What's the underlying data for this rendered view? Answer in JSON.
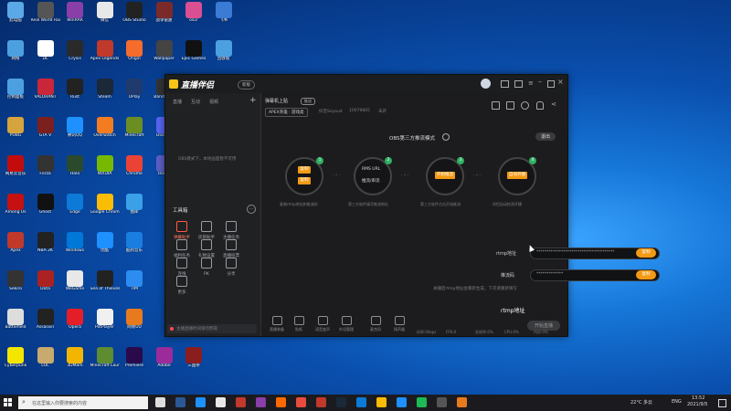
{
  "desktop": {
    "icons": [
      {
        "label": "此电脑",
        "color": "#5aa9e6",
        "c": 0,
        "r": 0
      },
      {
        "label": "Real World Racing",
        "color": "#555",
        "c": 1,
        "r": 0
      },
      {
        "label": "WinRAR",
        "color": "#8a3ea8",
        "c": 2,
        "r": 0
      },
      {
        "label": "微信",
        "color": "#e8e8e8",
        "c": 3,
        "r": 0
      },
      {
        "label": "OBS Studio",
        "color": "#222",
        "c": 4,
        "r": 0
      },
      {
        "label": "战争雷霆",
        "color": "#7b2a2a",
        "c": 5,
        "r": 0
      },
      {
        "label": "osu!",
        "color": "#d94f92",
        "c": 6,
        "r": 0
      },
      {
        "label": "飞书",
        "color": "#3a7bd5",
        "c": 7,
        "r": 0
      },
      {
        "label": "网络",
        "color": "#4da0e0",
        "c": 0,
        "r": 1
      },
      {
        "label": "DL",
        "color": "#fff",
        "c": 1,
        "r": 1
      },
      {
        "label": "Crysis",
        "color": "#2a2a2a",
        "c": 2,
        "r": 1
      },
      {
        "label": "Apex Legends",
        "color": "#c0392b",
        "c": 3,
        "r": 1
      },
      {
        "label": "Origin",
        "color": "#f56c2d",
        "c": 4,
        "r": 1
      },
      {
        "label": "Wallpaper",
        "color": "#444",
        "c": 5,
        "r": 1
      },
      {
        "label": "Epic Games",
        "color": "#111",
        "c": 6,
        "r": 1
      },
      {
        "label": "回收站",
        "color": "#4da0e0",
        "c": 7,
        "r": 1
      },
      {
        "label": "控制面板",
        "color": "#4da0e0",
        "c": 0,
        "r": 2
      },
      {
        "label": "VALORANT",
        "color": "#c9263a",
        "c": 1,
        "r": 2
      },
      {
        "label": "Rust",
        "color": "#222",
        "c": 2,
        "r": 2
      },
      {
        "label": "Steam",
        "color": "#1b2838",
        "c": 3,
        "r": 2
      },
      {
        "label": "UPlay",
        "color": "#203a6e",
        "c": 4,
        "r": 2
      },
      {
        "label": "Bandicam",
        "color": "#333",
        "c": 5,
        "r": 2
      },
      {
        "label": "直播伴侣",
        "color": "#111",
        "c": 6,
        "r": 2
      },
      {
        "label": "PUBG",
        "color": "#d6a43c",
        "c": 0,
        "r": 3
      },
      {
        "label": "GTA V",
        "color": "#7c1f1f",
        "c": 1,
        "r": 3
      },
      {
        "label": "腾讯QQ",
        "color": "#1e90ff",
        "c": 2,
        "r": 3
      },
      {
        "label": "Overwatch",
        "color": "#f47c20",
        "c": 3,
        "r": 3
      },
      {
        "label": "Minecraft",
        "color": "#6b8e23",
        "c": 4,
        "r": 3
      },
      {
        "label": "Discord",
        "color": "#5865f2",
        "c": 5,
        "r": 3
      },
      {
        "label": "网易云音乐",
        "color": "#c20c0c",
        "c": 0,
        "r": 4
      },
      {
        "label": "Forza",
        "color": "#333",
        "c": 1,
        "r": 4
      },
      {
        "label": "Halo",
        "color": "#2b4a2b",
        "c": 2,
        "r": 4
      },
      {
        "label": "NVIDIA",
        "color": "#76b900",
        "c": 3,
        "r": 4
      },
      {
        "label": "Chrome",
        "color": "#ea4335",
        "c": 4,
        "r": 4
      },
      {
        "label": "Teams",
        "color": "#5b5fc7",
        "c": 5,
        "r": 4
      },
      {
        "label": "Among Us",
        "color": "#c51111",
        "c": 0,
        "r": 5
      },
      {
        "label": "Ghost",
        "color": "#111",
        "c": 1,
        "r": 5
      },
      {
        "label": "Edge",
        "color": "#0c7ad6",
        "c": 2,
        "r": 5
      },
      {
        "label": "Google Chrome",
        "color": "#fbbc05",
        "c": 3,
        "r": 5
      },
      {
        "label": "图库",
        "color": "#3aa0e8",
        "c": 4,
        "r": 5
      },
      {
        "label": "Apex",
        "color": "#c0392b",
        "c": 0,
        "r": 6
      },
      {
        "label": "NBA 2K",
        "color": "#222",
        "c": 1,
        "r": 6
      },
      {
        "label": "Windows",
        "color": "#0078d7",
        "c": 2,
        "r": 6
      },
      {
        "label": "优酷",
        "color": "#1e90ff",
        "c": 3,
        "r": 6
      },
      {
        "label": "酷狗音乐",
        "color": "#1a7de0",
        "c": 4,
        "r": 6
      },
      {
        "label": "Sekiro",
        "color": "#333",
        "c": 0,
        "r": 7
      },
      {
        "label": "Dota",
        "color": "#a22",
        "c": 1,
        "r": 7
      },
      {
        "label": "WeGame",
        "color": "#e8e8e8",
        "c": 2,
        "r": 7
      },
      {
        "label": "Sea of Thieves",
        "color": "#222",
        "c": 3,
        "r": 7
      },
      {
        "label": "TIM",
        "color": "#2d8cf0",
        "c": 4,
        "r": 7
      },
      {
        "label": "Battlefield",
        "color": "#ddd",
        "c": 0,
        "r": 8
      },
      {
        "label": "Assassin",
        "color": "#222",
        "c": 1,
        "r": 8
      },
      {
        "label": "Opera",
        "color": "#e41e26",
        "c": 2,
        "r": 8
      },
      {
        "label": "PotPlayer",
        "color": "#f0f0f0",
        "c": 3,
        "r": 8
      },
      {
        "label": "网易UU",
        "color": "#e87a1e",
        "c": 4,
        "r": 8
      },
      {
        "label": "Cyberpunk",
        "color": "#f3e600",
        "c": 0,
        "r": 9
      },
      {
        "label": "LOL",
        "color": "#c8aa6e",
        "c": 1,
        "r": 9
      },
      {
        "label": "3DMark",
        "color": "#f2b600",
        "c": 2,
        "r": 9
      },
      {
        "label": "Minecraft Launcher",
        "color": "#5e8c31",
        "c": 3,
        "r": 9
      },
      {
        "label": "Premiere",
        "color": "#2a0a4a",
        "c": 4,
        "r": 9
      },
      {
        "label": "Adobe",
        "color": "#9b2b9b",
        "c": 5,
        "r": 9
      },
      {
        "label": "三国杀",
        "color": "#8a1e1e",
        "c": 6,
        "r": 9
      }
    ]
  },
  "app": {
    "logo_text": "直播伴侣",
    "version_badge": "新版",
    "left_tabs": [
      "直播",
      "互动",
      "视频"
    ],
    "add_label": "+",
    "scene_hint": "OBS模式下，本地画面暂不可用",
    "room_title": "弹幕机上贴",
    "room_tag": "推送",
    "room_game": "APEX英雄 · 游戏类",
    "room_name": "抖音Seyouit",
    "room_id": "10079845",
    "room_status": "未开",
    "toolbox_title": "工具箱",
    "tools": [
      {
        "label": "弹幕助手",
        "active": true
      },
      {
        "label": "房管助手",
        "active": false
      },
      {
        "label": "主播任务",
        "active": false
      },
      {
        "label": "福利任务",
        "active": false
      },
      {
        "label": "礼物设置",
        "active": false
      },
      {
        "label": "直播投票",
        "active": false
      },
      {
        "label": "连线",
        "active": false
      },
      {
        "label": "PK",
        "active": false
      },
      {
        "label": "分享",
        "active": false
      },
      {
        "label": "更多",
        "active": false
      }
    ],
    "tip_text": "主播直播时间请勿熬夜",
    "mode_title": "OBS第三方推流模式",
    "exit_label": "退出",
    "steps": [
      {
        "num": "1",
        "btns": [
          "复制",
          "复制"
        ],
        "caption": "复制rtmp地址和推流码"
      },
      {
        "num": "2",
        "top": "RMS URL",
        "bottom": "推流/串流",
        "caption": "第三方软件填写推流地址"
      },
      {
        "num": "3",
        "btns": [
          "开始推流"
        ],
        "caption": "第三方软件点击开始推流"
      },
      {
        "num": "4",
        "btns": [
          "自动开播"
        ],
        "caption": "伴侣自动检测开播"
      }
    ],
    "rtmp_label": "rtmp地址",
    "rtmp_value": "**************************************",
    "stream_label": "推流码",
    "stream_value": "*************",
    "copy_label": "复制",
    "notice": "关播后rtmp地址会重新生成，下次请重新填写",
    "bottom_items": [
      "直播装备",
      "贴纸",
      "语音变声",
      "外设管理",
      "麦克风",
      "扬声器"
    ],
    "start_label": "开始直播",
    "status_line": [
      "码率:0kbps",
      "FPS:0",
      "丢帧率:0%",
      "CPU:0%",
      "内存:0%"
    ]
  },
  "taskbar": {
    "search_placeholder": "在这里输入你要搜索的内容",
    "weather": "22°C 多云",
    "lang": "ENG",
    "time": "13:52",
    "date": "2021/9/5"
  }
}
